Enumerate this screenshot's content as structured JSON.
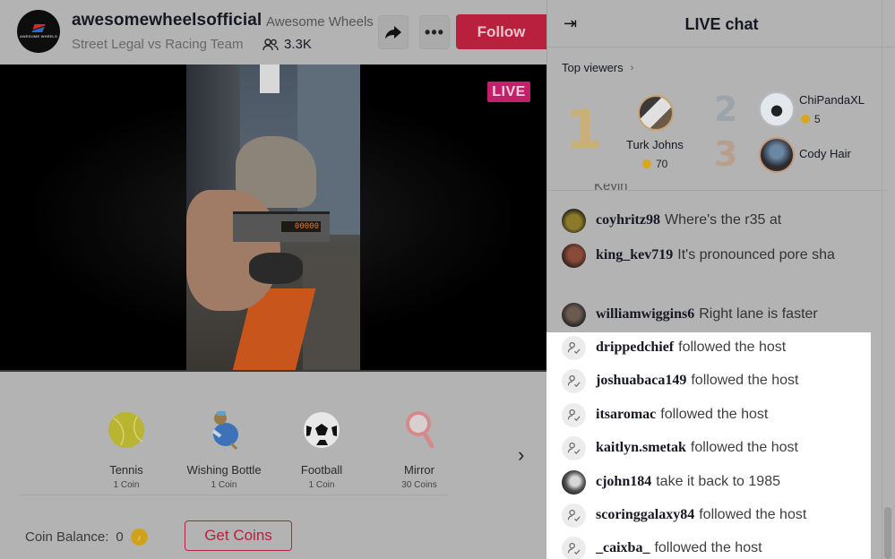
{
  "header": {
    "host_username": "awesomewheelsofficial",
    "host_nickname": "Awesome Wheels",
    "host_description": "Street Legal vs Racing Team",
    "host_logo_text": "AWESOME WHEELS",
    "viewer_count": "3.3K",
    "share_icon": "share-arrow-icon",
    "more_label": "•••",
    "follow_label": "Follow"
  },
  "video": {
    "live_badge": "LIVE",
    "timer_display": "00000"
  },
  "gifts": {
    "items": [
      {
        "name": "Tennis",
        "price": "1 Coin",
        "icon": "tennis-ball-icon"
      },
      {
        "name": "Wishing Bottle",
        "price": "1 Coin",
        "icon": "wishing-bottle-icon"
      },
      {
        "name": "Football",
        "price": "1 Coin",
        "icon": "football-icon"
      },
      {
        "name": "Mirror",
        "price": "30 Coins",
        "icon": "mirror-icon"
      }
    ],
    "next_label": "›",
    "coin_balance_label": "Coin Balance:",
    "coin_balance_value": "0",
    "get_coins_label": "Get Coins"
  },
  "chat": {
    "title": "LIVE chat",
    "collapse_icon": "⇥",
    "top_viewers_label": "Top viewers",
    "top_viewers_chevron": "›",
    "top_viewers": [
      {
        "rank": "1",
        "name": "Turk Johns",
        "coins": "70"
      },
      {
        "rank": "2",
        "name": "ChiPandaXL",
        "coins": "5"
      },
      {
        "rank": "3",
        "name": "Cody Hair"
      }
    ],
    "cut_off_text": "Kevin",
    "messages": [
      {
        "user": "coyhritz98",
        "text": "Where's the r35 at",
        "type": "comment"
      },
      {
        "user": "king_kev719",
        "text": "It's pronounced pore sha",
        "type": "comment"
      },
      {
        "user": "williamwiggins6",
        "text": "Right lane is faster",
        "type": "comment"
      },
      {
        "user": "drippedchief",
        "text": "followed the host",
        "type": "follow"
      },
      {
        "user": "joshuabaca149",
        "text": "followed the host",
        "type": "follow"
      },
      {
        "user": "itsaromac",
        "text": "followed the host",
        "type": "follow"
      },
      {
        "user": "kaitlyn.smetak",
        "text": "followed the host",
        "type": "follow"
      },
      {
        "user": "cjohn184",
        "text": "take it back to 1985",
        "type": "comment"
      },
      {
        "user": "scoringgalaxy84",
        "text": "followed the host",
        "type": "follow"
      },
      {
        "user": "_caixba_",
        "text": "followed the host",
        "type": "follow"
      }
    ]
  },
  "colors": {
    "brand_red": "#b8203d",
    "live_pink": "#c41f6b",
    "coin_gold": "#d2a11b",
    "overlay_gray": "#b3b3b3",
    "highlight_white": "#ffffff"
  }
}
